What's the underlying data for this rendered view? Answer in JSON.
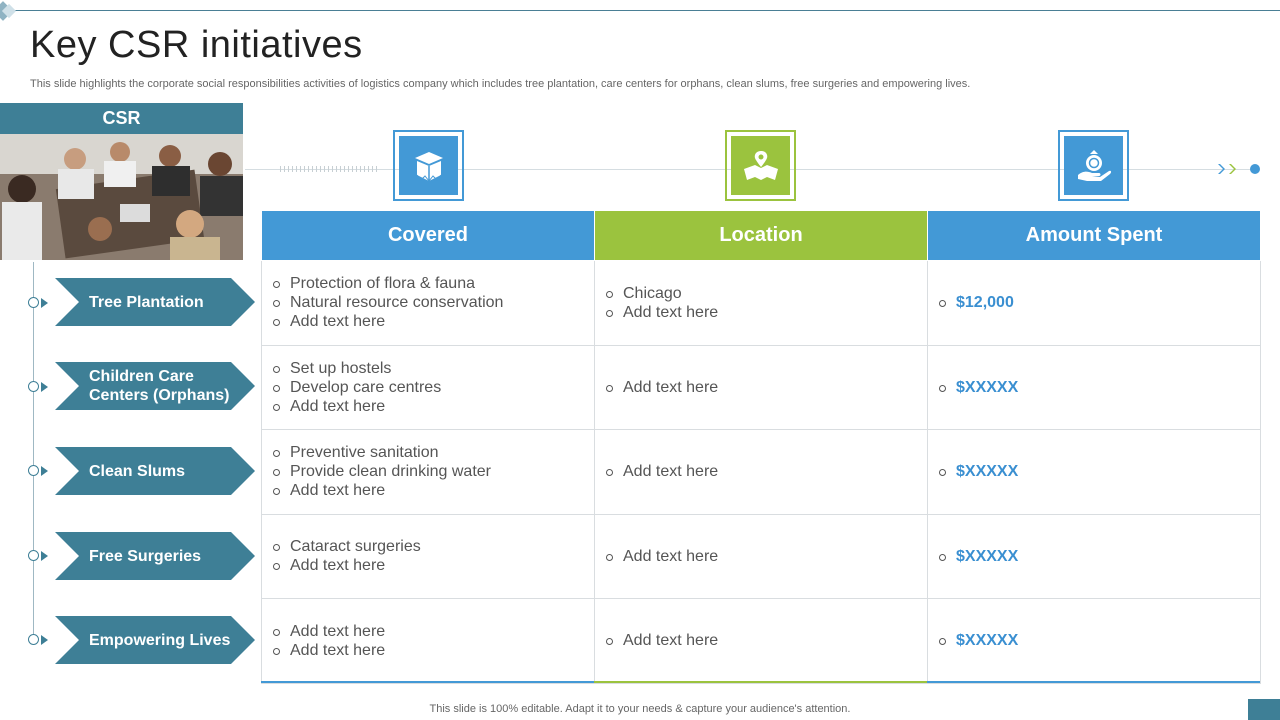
{
  "header": {
    "title": "Key CSR initiatives",
    "subtitle": "This slide highlights the corporate social responsibilities activities of logistics company which includes tree plantation, care centers for orphans, clean slums, free surgeries and empowering lives."
  },
  "sidebar": {
    "heading": "CSR",
    "items": [
      {
        "label": "Tree Plantation"
      },
      {
        "label": "Children Care Centers (Orphans)"
      },
      {
        "label": "Clean Slums"
      },
      {
        "label": "Free Surgeries"
      },
      {
        "label": "Empowering Lives"
      }
    ]
  },
  "icons": [
    "gift-box-icon",
    "map-location-icon",
    "money-hand-icon"
  ],
  "table": {
    "columns": [
      "Covered",
      "Location",
      "Amount Spent"
    ],
    "rows": [
      {
        "covered": [
          "Protection of flora & fauna",
          "Natural resource conservation",
          "Add text here"
        ],
        "location": [
          "Chicago",
          "Add text here"
        ],
        "amount": "$12,000"
      },
      {
        "covered": [
          "Set up hostels",
          "Develop care centres",
          "Add text here"
        ],
        "location": [
          "Add text here"
        ],
        "amount": "$XXXXX"
      },
      {
        "covered": [
          "Preventive sanitation",
          "Provide clean drinking water",
          "Add text here"
        ],
        "location": [
          "Add text here"
        ],
        "amount": "$XXXXX"
      },
      {
        "covered": [
          "Cataract surgeries",
          "Add text here"
        ],
        "location": [
          "Add text here"
        ],
        "amount": "$XXXXX"
      },
      {
        "covered": [
          "Add text here",
          "Add text here"
        ],
        "location": [
          "Add text here"
        ],
        "amount": "$XXXXX"
      }
    ]
  },
  "colors": {
    "teal": "#3e7f96",
    "blue": "#4399d6",
    "green": "#9bc33e"
  },
  "footer": {
    "note": "This slide is 100% editable.  Adapt it to your needs & capture your audience's attention."
  }
}
